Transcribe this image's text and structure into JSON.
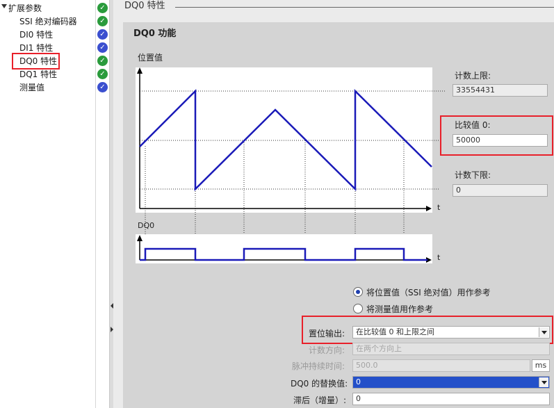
{
  "nav": {
    "root_label": "扩展参数",
    "items": [
      {
        "label": "SSI 绝对编码器",
        "status": "ok"
      },
      {
        "label": "DI0 特性",
        "status": "info"
      },
      {
        "label": "DI1 特性",
        "status": "info"
      },
      {
        "label": "DQ0 特性",
        "status": "ok"
      },
      {
        "label": "DQ1 特性",
        "status": "ok"
      },
      {
        "label": "测量值",
        "status": "info"
      }
    ],
    "root_status": "ok"
  },
  "header": {
    "title": "DQ0 特性"
  },
  "section": {
    "title": "DQ0 功能"
  },
  "diagram": {
    "position_label": "位置值",
    "output_label": "DQ0",
    "t_label": "t",
    "t_label2": "t",
    "line_color": "#1a1ab8"
  },
  "limits": {
    "upper_label": "计数上限:",
    "upper_value": "33554431",
    "compare_label": "比较值 0:",
    "compare_value": "50000",
    "lower_label": "计数下限:",
    "lower_value": "0"
  },
  "reference": {
    "option1": "将位置值（SSI 绝对值）用作参考",
    "option2": "将测量值用作参考",
    "selected": 1
  },
  "settings": {
    "set_output_label": "置位输出:",
    "set_output_value": "在比较值 0 和上限之间",
    "count_dir_label": "计数方向:",
    "count_dir_value": "在两个方向上",
    "pulse_label": "脉冲持续时间:",
    "pulse_value": "500.0",
    "pulse_unit": "ms",
    "substitute_label": "DQ0 的替换值:",
    "substitute_value": "0",
    "hysteresis_label": "滞后（增量）:",
    "hysteresis_value": "0"
  }
}
